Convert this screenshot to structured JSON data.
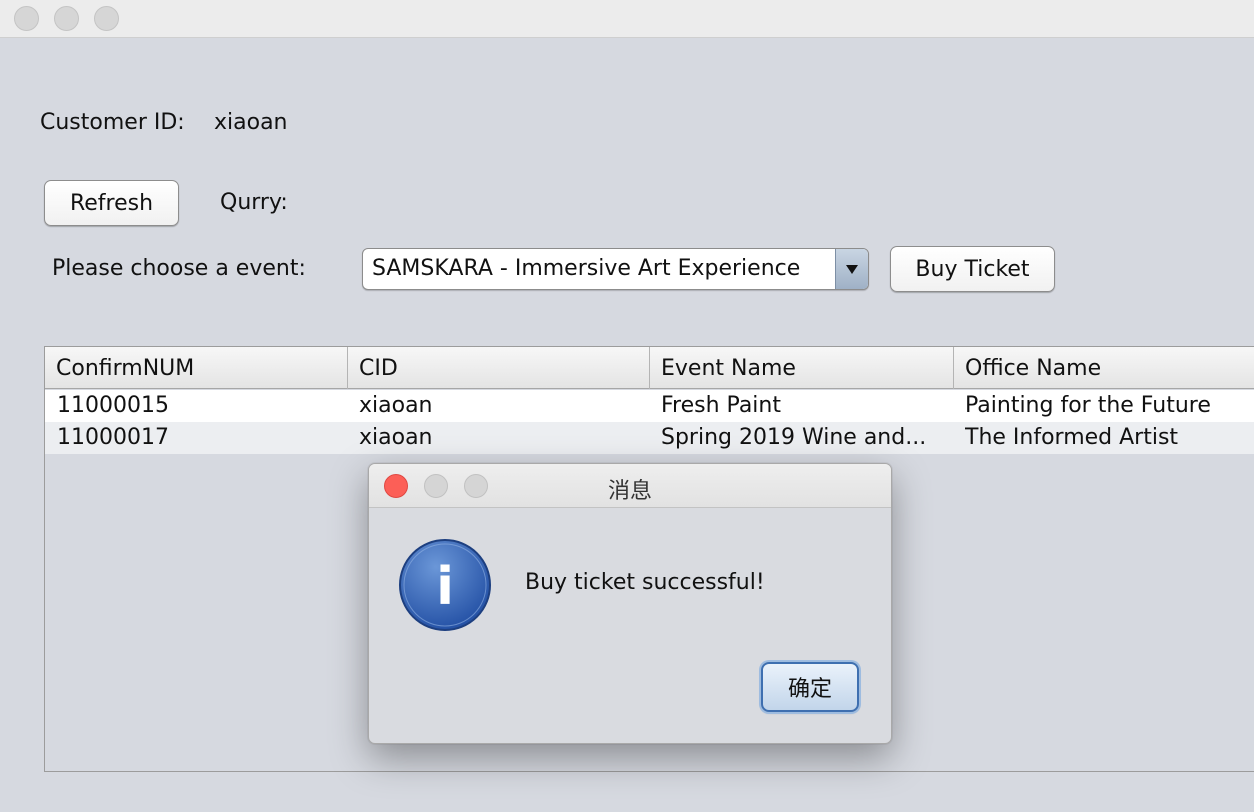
{
  "window": {
    "traffic_lights": [
      "close",
      "minimize",
      "zoom"
    ]
  },
  "customer": {
    "label": "Customer ID:",
    "value": "xiaoan"
  },
  "toolbar": {
    "refresh_label": "Refresh",
    "query_label": "Qurry:"
  },
  "event_picker": {
    "label": "Please choose a event:",
    "selected": "SAMSKARA - Immersive Art Experience",
    "buy_label": "Buy Ticket"
  },
  "table": {
    "columns": [
      "ConfirmNUM",
      "CID",
      "Event Name",
      "Office Name"
    ],
    "rows": [
      [
        "11000015",
        "xiaoan",
        "Fresh Paint",
        "Painting for the Future"
      ],
      [
        "11000017",
        "xiaoan",
        "Spring 2019 Wine and...",
        "The Informed Artist"
      ]
    ]
  },
  "dialog": {
    "title": "消息",
    "message": "Buy ticket successful!",
    "ok_label": "确定",
    "icon": "info-icon",
    "icon_letter": "i",
    "colors": {
      "icon_blue": "#3466b8",
      "close_red": "#fc5f57",
      "ok_border": "#3e6fb0"
    }
  }
}
